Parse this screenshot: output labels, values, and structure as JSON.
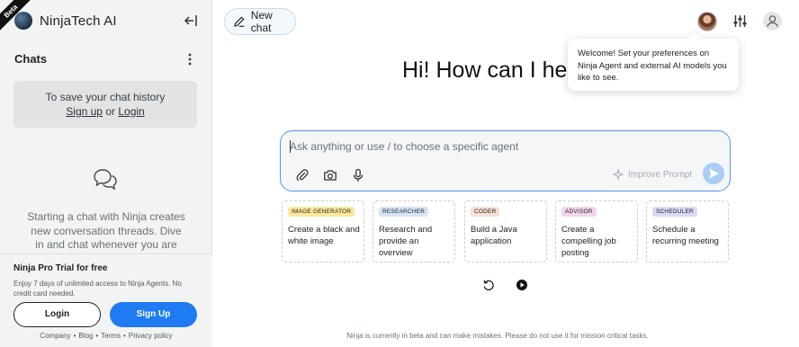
{
  "sidebar": {
    "beta_label": "Beta",
    "brand_name": "NinjaTech AI",
    "chats_title": "Chats",
    "history": {
      "text": "To save your chat history",
      "signup_link": "Sign up",
      "or_text": "or",
      "login_link": "Login"
    },
    "empty_state": "Starting a chat with Ninja creates new conversation threads. Dive in and chat whenever you are ready.",
    "trial": {
      "title": "Ninja Pro Trial for free",
      "description": "Enjoy 7 days of unlimited access to Ninja Agents. No credit card needed.",
      "login_label": "Login",
      "signup_label": "Sign Up",
      "footer_links": [
        "Company",
        "Blog",
        "Terms",
        "Privacy policy"
      ]
    }
  },
  "header": {
    "new_chat_label": "New chat"
  },
  "tooltip": {
    "text": "Welcome! Set your preferences on Ninja Agent and external AI models you like to see."
  },
  "main": {
    "greeting": "Hi! How can I help you?",
    "prompt": {
      "placeholder": "Ask anything or use / to choose a specific agent",
      "value": "",
      "improve_label": "Improve Prompt"
    },
    "cards": [
      {
        "tag": "IMAGE GENERATOR",
        "text": "Create a black and white image",
        "tag_color": "#fbe89a"
      },
      {
        "tag": "RESEARCHER",
        "text": "Research and provide an overview",
        "tag_color": "#d5e6f5"
      },
      {
        "tag": "CODER",
        "text": "Build a Java application",
        "tag_color": "#f8dfd3"
      },
      {
        "tag": "ADVISOR",
        "text": "Create a compelling job posting",
        "tag_color": "#f3d5ec"
      },
      {
        "tag": "SCHEDULER",
        "text": "Schedule a recurring meeting",
        "tag_color": "#d9dbf6"
      }
    ],
    "disclaimer": "Ninja is currently in beta and can make mistakes. Please do not use it for mission critical tasks."
  },
  "icons": [
    "collapse-sidebar-icon",
    "more-options-icon",
    "chat-bubbles-icon",
    "edit-icon",
    "sliders-icon",
    "user-icon",
    "attach-icon",
    "camera-icon",
    "microphone-icon",
    "sparkle-icon",
    "send-arrow-icon",
    "refresh-icon",
    "play-icon"
  ],
  "colors": {
    "accent": "#1f7bf2",
    "prompt_border": "#4f97e8",
    "send_button": "#a9cdf5",
    "sidebar_bg": "#f2f3f3"
  }
}
